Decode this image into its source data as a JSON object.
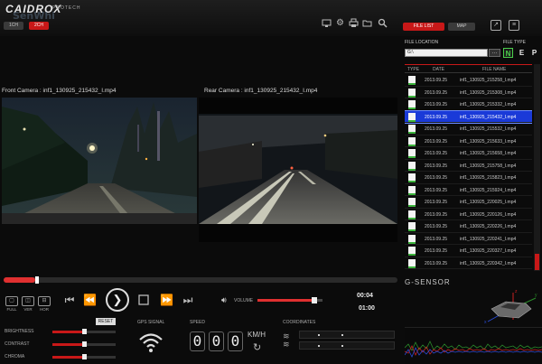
{
  "app": {
    "logo": "CAIDROX",
    "logo_sub": "PROTECH",
    "watermark": "SenWhi"
  },
  "channel_buttons": {
    "one": "1CH",
    "two": "2CH"
  },
  "top_icons": [
    "monitor-icon",
    "gear-icon",
    "print-icon",
    "folder-icon",
    "search-icon"
  ],
  "tabs": {
    "file_list": "FILE LIST",
    "map": "MAP"
  },
  "cameras": {
    "front_label": "Front Camera : inf1_130925_215432_I.mp4",
    "rear_label": "Rear Camera : inf1_130925_215432_I.mp4"
  },
  "file_panel": {
    "location_label": "FILE LOCATION",
    "location_value": "G:\\",
    "file_type_label": "FILE TYPE",
    "types": [
      "N",
      "E",
      "P"
    ],
    "columns": {
      "type": "TYPE",
      "date": "DATE",
      "name": "FILE NAME"
    },
    "files": [
      {
        "date": "2013.09.25",
        "name": "inf1_130925_215258_I.mp4"
      },
      {
        "date": "2013.09.25",
        "name": "inf1_130925_215308_I.mp4"
      },
      {
        "date": "2013.09.25",
        "name": "inf1_130925_215332_I.mp4"
      },
      {
        "date": "2013.09.25",
        "name": "inf1_130925_215432_I.mp4"
      },
      {
        "date": "2013.09.25",
        "name": "inf1_130925_215532_I.mp4"
      },
      {
        "date": "2013.09.25",
        "name": "inf1_130925_215633_I.mp4"
      },
      {
        "date": "2013.09.25",
        "name": "inf1_130925_215658_I.mp4"
      },
      {
        "date": "2013.09.25",
        "name": "inf1_130925_215758_I.mp4"
      },
      {
        "date": "2013.09.25",
        "name": "inf1_130925_215823_I.mp4"
      },
      {
        "date": "2013.09.25",
        "name": "inf1_130925_215924_I.mp4"
      },
      {
        "date": "2013.09.25",
        "name": "inf1_130925_220025_I.mp4"
      },
      {
        "date": "2013.09.25",
        "name": "inf1_130925_220126_I.mp4"
      },
      {
        "date": "2013.09.25",
        "name": "inf1_130925_220226_I.mp4"
      },
      {
        "date": "2013.09.25",
        "name": "inf1_130925_220241_I.mp4"
      },
      {
        "date": "2013.09.25",
        "name": "inf1_130925_220327_I.mp4"
      },
      {
        "date": "2013.09.25",
        "name": "inf1_130925_220342_I.mp4"
      }
    ],
    "selected_index": 3
  },
  "playback": {
    "progress": 0.08,
    "view_buttons": [
      "FULL",
      "VER",
      "HOR"
    ],
    "volume_label": "VOLUME",
    "volume_level": 0.92,
    "time_current": "00:04",
    "time_total": "01:00"
  },
  "adjust": {
    "reset": "RESET",
    "items": [
      {
        "label": "BRIGHTNESS",
        "level": 0.5
      },
      {
        "label": "CONTRAST",
        "level": 0.5
      },
      {
        "label": "CHROMA",
        "level": 0.5
      }
    ]
  },
  "gps": {
    "label": "GPS SIGNAL"
  },
  "speed": {
    "label": "SPEED",
    "digits": [
      "0",
      "0",
      "0"
    ],
    "unit": "KM/H"
  },
  "coordinates": {
    "label": "COORDINATES"
  },
  "gsensor": {
    "title": "G-SENSOR"
  },
  "colors": {
    "accent": "#c81818",
    "selected_row": "#1a3ad8",
    "file_ok": "#3cb43c"
  }
}
